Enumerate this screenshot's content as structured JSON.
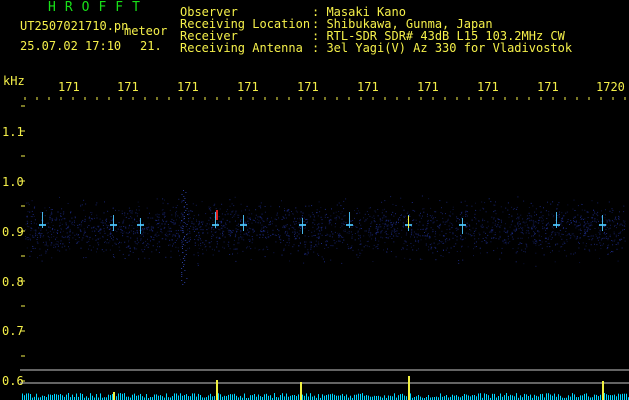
{
  "header": {
    "app_name": "HROFFT",
    "file_name": "UT2507021710.pn",
    "file_suffix": "meteor",
    "timestamp": "25.07.02 17:10",
    "number": "21.",
    "info_labels": [
      "Observer",
      "Receiving Location",
      "Receiver",
      "Receiving Antenna"
    ],
    "info_values": [
      ": Masaki Kano",
      ": Shibukawa, Gunma, Japan",
      ": RTL-SDR SDR# 43dB L15 103.2MHz CW",
      ": 3el Yagi(V) Az 330 for Vladivostok"
    ]
  },
  "axis": {
    "unit": "kHz",
    "time_labels": [
      "171",
      "171",
      "171",
      "171",
      "171",
      "171",
      "171",
      "171",
      "171",
      "1720"
    ],
    "freq_labels": [
      "1.1",
      "1.0",
      "0.9",
      "0.8",
      "0.7",
      "0.6"
    ]
  },
  "colors": {
    "text": "#f5f04a",
    "title": "#18e018",
    "axis": "#f5f04a",
    "noise": "#1e2d8c",
    "echo": "#4cc8ff",
    "meter": "#00d6ff"
  }
}
